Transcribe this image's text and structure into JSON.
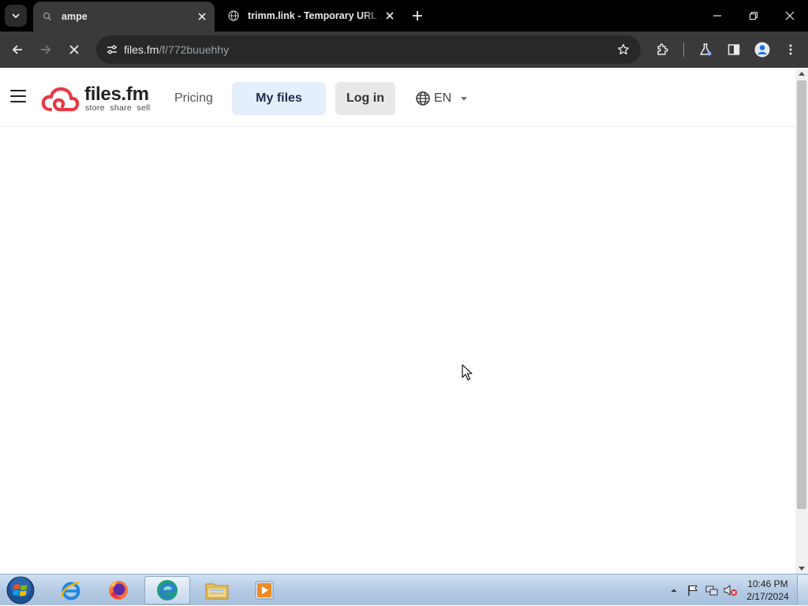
{
  "browser": {
    "tabs": [
      {
        "title": "ampe",
        "active": true
      },
      {
        "title": "trimm.link - Temporary URL shortener",
        "active": false
      }
    ],
    "address": {
      "host": "files.fm",
      "path": "/f/772buuehhy"
    }
  },
  "site": {
    "logo_name": "files.fm",
    "logo_tagline": "store  share  sell",
    "nav": {
      "pricing": "Pricing",
      "my_files": "My files",
      "log_in": "Log in",
      "language": "EN"
    }
  },
  "taskbar": {
    "time": "10:46 PM",
    "date": "2/17/2024"
  },
  "colors": {
    "brand_red": "#e63946",
    "my_files_bg": "#e5eefb",
    "login_bg": "#e8e8e8",
    "chrome_dark": "#3a3a3a"
  }
}
